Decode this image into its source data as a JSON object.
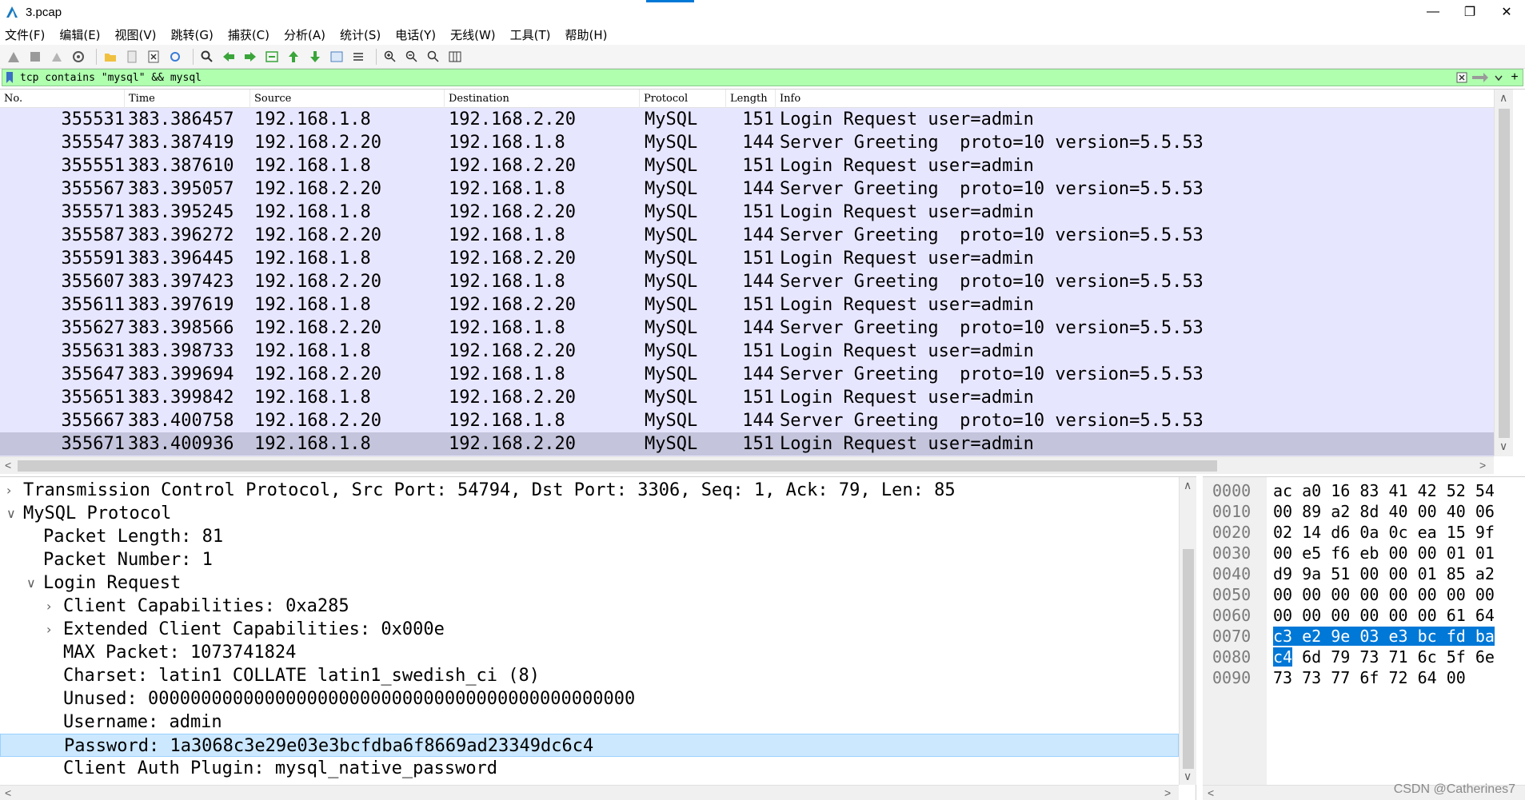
{
  "window": {
    "title": "3.pcap"
  },
  "menu": [
    "文件(F)",
    "编辑(E)",
    "视图(V)",
    "跳转(G)",
    "捕获(C)",
    "分析(A)",
    "统计(S)",
    "电话(Y)",
    "无线(W)",
    "工具(T)",
    "帮助(H)"
  ],
  "filter": {
    "value": "tcp contains \"mysql\" && mysql"
  },
  "packet_list": {
    "columns": [
      "No.",
      "Time",
      "Source",
      "Destination",
      "Protocol",
      "Length",
      "Info"
    ],
    "rows": [
      {
        "no": "355531",
        "time": "383.386457",
        "src": "192.168.1.8",
        "dst": "192.168.2.20",
        "proto": "MySQL",
        "len": "151",
        "info": "Login Request user=admin"
      },
      {
        "no": "355547",
        "time": "383.387419",
        "src": "192.168.2.20",
        "dst": "192.168.1.8",
        "proto": "MySQL",
        "len": "144",
        "info": "Server Greeting  proto=10 version=5.5.53"
      },
      {
        "no": "355551",
        "time": "383.387610",
        "src": "192.168.1.8",
        "dst": "192.168.2.20",
        "proto": "MySQL",
        "len": "151",
        "info": "Login Request user=admin"
      },
      {
        "no": "355567",
        "time": "383.395057",
        "src": "192.168.2.20",
        "dst": "192.168.1.8",
        "proto": "MySQL",
        "len": "144",
        "info": "Server Greeting  proto=10 version=5.5.53"
      },
      {
        "no": "355571",
        "time": "383.395245",
        "src": "192.168.1.8",
        "dst": "192.168.2.20",
        "proto": "MySQL",
        "len": "151",
        "info": "Login Request user=admin"
      },
      {
        "no": "355587",
        "time": "383.396272",
        "src": "192.168.2.20",
        "dst": "192.168.1.8",
        "proto": "MySQL",
        "len": "144",
        "info": "Server Greeting  proto=10 version=5.5.53"
      },
      {
        "no": "355591",
        "time": "383.396445",
        "src": "192.168.1.8",
        "dst": "192.168.2.20",
        "proto": "MySQL",
        "len": "151",
        "info": "Login Request user=admin"
      },
      {
        "no": "355607",
        "time": "383.397423",
        "src": "192.168.2.20",
        "dst": "192.168.1.8",
        "proto": "MySQL",
        "len": "144",
        "info": "Server Greeting  proto=10 version=5.5.53"
      },
      {
        "no": "355611",
        "time": "383.397619",
        "src": "192.168.1.8",
        "dst": "192.168.2.20",
        "proto": "MySQL",
        "len": "151",
        "info": "Login Request user=admin"
      },
      {
        "no": "355627",
        "time": "383.398566",
        "src": "192.168.2.20",
        "dst": "192.168.1.8",
        "proto": "MySQL",
        "len": "144",
        "info": "Server Greeting  proto=10 version=5.5.53"
      },
      {
        "no": "355631",
        "time": "383.398733",
        "src": "192.168.1.8",
        "dst": "192.168.2.20",
        "proto": "MySQL",
        "len": "151",
        "info": "Login Request user=admin"
      },
      {
        "no": "355647",
        "time": "383.399694",
        "src": "192.168.2.20",
        "dst": "192.168.1.8",
        "proto": "MySQL",
        "len": "144",
        "info": "Server Greeting  proto=10 version=5.5.53"
      },
      {
        "no": "355651",
        "time": "383.399842",
        "src": "192.168.1.8",
        "dst": "192.168.2.20",
        "proto": "MySQL",
        "len": "151",
        "info": "Login Request user=admin"
      },
      {
        "no": "355667",
        "time": "383.400758",
        "src": "192.168.2.20",
        "dst": "192.168.1.8",
        "proto": "MySQL",
        "len": "144",
        "info": "Server Greeting  proto=10 version=5.5.53"
      },
      {
        "no": "355671",
        "time": "383.400936",
        "src": "192.168.1.8",
        "dst": "192.168.2.20",
        "proto": "MySQL",
        "len": "151",
        "info": "Login Request user=admin",
        "selected": true
      }
    ]
  },
  "details": [
    {
      "level": 0,
      "arrow": "collapsed",
      "text": "Transmission Control Protocol, Src Port: 54794, Dst Port: 3306, Seq: 1, Ack: 79, Len: 85"
    },
    {
      "level": 0,
      "arrow": "expanded",
      "text": "MySQL Protocol"
    },
    {
      "level": 1,
      "arrow": "none",
      "text": "Packet Length: 81"
    },
    {
      "level": 1,
      "arrow": "none",
      "text": "Packet Number: 1"
    },
    {
      "level": 1,
      "arrow": "expanded",
      "text": "Login Request"
    },
    {
      "level": 2,
      "arrow": "collapsed",
      "text": "Client Capabilities: 0xa285"
    },
    {
      "level": 2,
      "arrow": "collapsed",
      "text": "Extended Client Capabilities: 0x000e"
    },
    {
      "level": 2,
      "arrow": "none",
      "text": "MAX Packet: 1073741824"
    },
    {
      "level": 2,
      "arrow": "none",
      "text": "Charset: latin1 COLLATE latin1_swedish_ci (8)"
    },
    {
      "level": 2,
      "arrow": "none",
      "text": "Unused: 0000000000000000000000000000000000000000000000"
    },
    {
      "level": 2,
      "arrow": "none",
      "text": "Username: admin"
    },
    {
      "level": 2,
      "arrow": "none",
      "text": "Password: 1a3068c3e29e03e3bcfdba6f8669ad23349dc6c4",
      "selected": true
    },
    {
      "level": 2,
      "arrow": "none",
      "text": "Client Auth Plugin: mysql_native_password"
    }
  ],
  "bytes": {
    "offsets": [
      "0000",
      "0010",
      "0020",
      "0030",
      "0040",
      "0050",
      "0060",
      "0070",
      "0080",
      "0090"
    ],
    "lines": [
      {
        "pre": "ac a0 16 83 41 42 52 54",
        "hl": "",
        "post": ""
      },
      {
        "pre": "00 89 a2 8d 40 00 40 06",
        "hl": "",
        "post": ""
      },
      {
        "pre": "02 14 d6 0a 0c ea 15 9f",
        "hl": "",
        "post": ""
      },
      {
        "pre": "00 e5 f6 eb 00 00 01 01",
        "hl": "",
        "post": ""
      },
      {
        "pre": "d9 9a 51 00 00 01 85 a2",
        "hl": "",
        "post": ""
      },
      {
        "pre": "00 00 00 00 00 00 00 00",
        "hl": "",
        "post": ""
      },
      {
        "pre": "00 00 00 00 00 00 61 64",
        "hl": "",
        "post": ""
      },
      {
        "pre": "",
        "hl": "c3 e2 9e 03 e3 bc fd ba",
        "post": ""
      },
      {
        "pre": "",
        "hl": "c4",
        "post": " 6d 79 73 71 6c 5f 6e"
      },
      {
        "pre": "73 73 77 6f 72 64 00",
        "hl": "",
        "post": ""
      }
    ]
  },
  "watermark": "CSDN @Catherines7",
  "colors": {
    "row_bg": "#e7e6ff",
    "row_selected": "#c4c4dc",
    "filter_ok": "#afffaf",
    "detail_selected": "#cce8ff",
    "byte_highlight": "#0078d7"
  }
}
